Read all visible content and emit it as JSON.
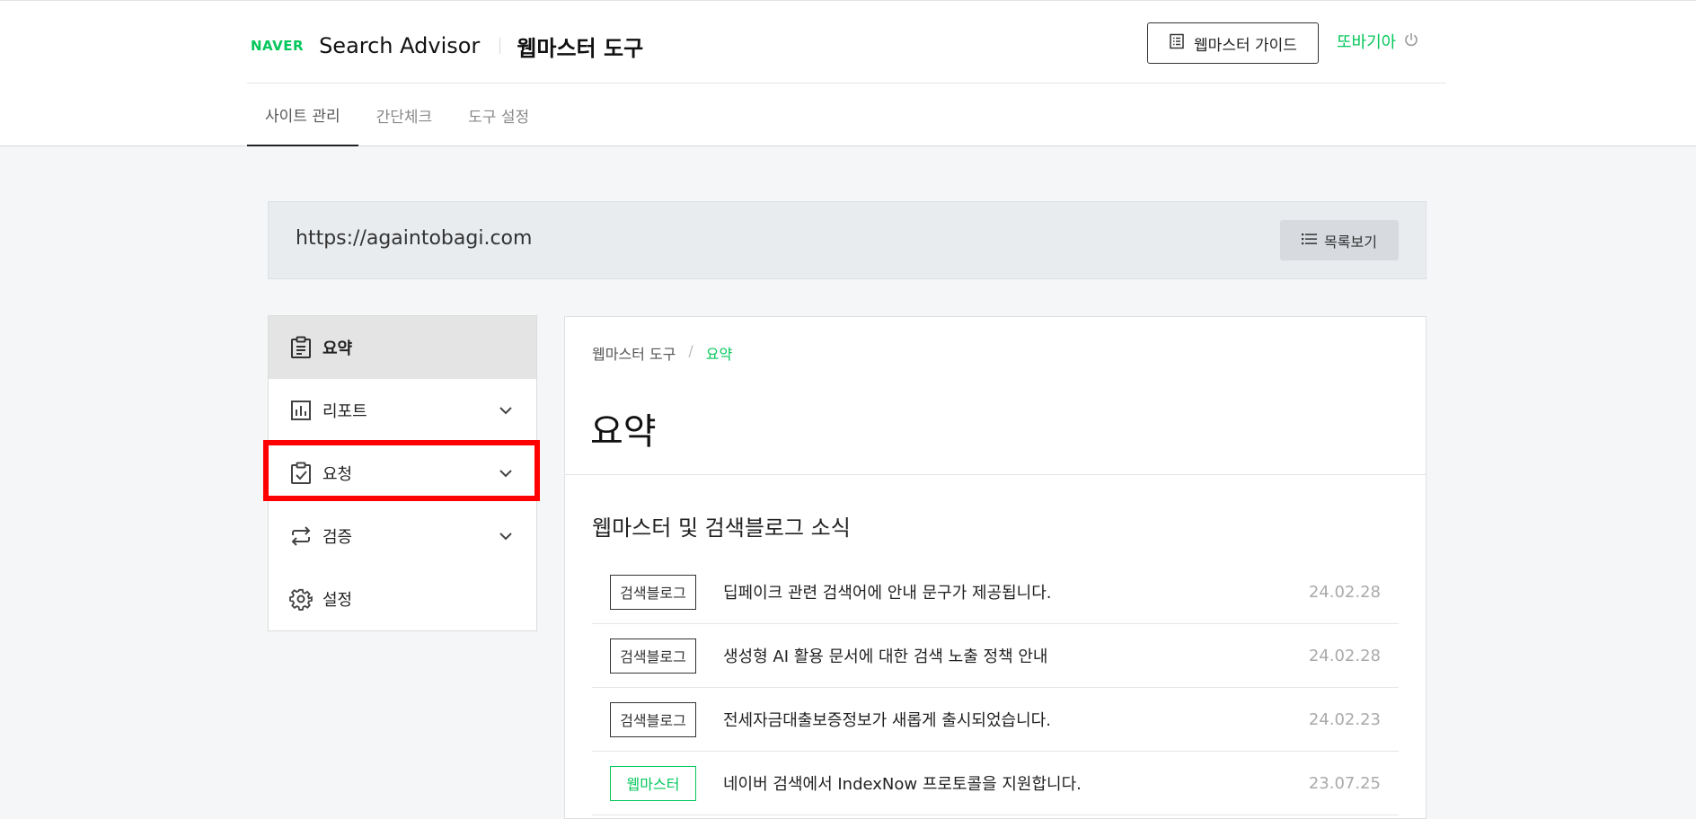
{
  "header": {
    "logo": "NAVER",
    "title": "Search Advisor",
    "subtitle": "웹마스터 도구",
    "guide_button": "웹마스터 가이드",
    "user_name": "또바기아"
  },
  "tabs": [
    {
      "label": "사이트 관리",
      "active": true
    },
    {
      "label": "간단체크",
      "active": false
    },
    {
      "label": "도구 설정",
      "active": false
    }
  ],
  "site": {
    "url": "https://againtobagi.com",
    "list_button": "목록보기"
  },
  "sidebar": {
    "items": [
      {
        "label": "요약",
        "icon": "clipboard-icon",
        "active": true
      },
      {
        "label": "리포트",
        "icon": "bar-chart-icon",
        "expandable": true
      },
      {
        "label": "요청",
        "icon": "clipboard-check-icon",
        "expandable": true,
        "highlighted": true
      },
      {
        "label": "검증",
        "icon": "repeat-arrows-icon",
        "expandable": true
      },
      {
        "label": "설정",
        "icon": "gear-icon"
      }
    ]
  },
  "main": {
    "breadcrumb": [
      "웹마스터 도구",
      "요약"
    ],
    "breadcrumb_sep": "/",
    "title": "요약",
    "section_title": "웹마스터 및 검색블로그 소식",
    "news": [
      {
        "category": "검색블로그",
        "title": "딥페이크 관련 검색어에 안내 문구가 제공됩니다.",
        "date": "24.02.28"
      },
      {
        "category": "검색블로그",
        "title": "생성형 AI 활용 문서에 대한 검색 노출 정책 안내",
        "date": "24.02.28"
      },
      {
        "category": "검색블로그",
        "title": "전세자금대출보증정보가 새롭게 출시되었습니다.",
        "date": "24.02.23"
      },
      {
        "category": "웹마스터",
        "title": "네이버 검색에서 IndexNow 프로토콜을 지원합니다.",
        "date": "23.07.25"
      }
    ]
  },
  "colors": {
    "brand_green": "#03c75a",
    "highlight_red": "#ff0000"
  }
}
